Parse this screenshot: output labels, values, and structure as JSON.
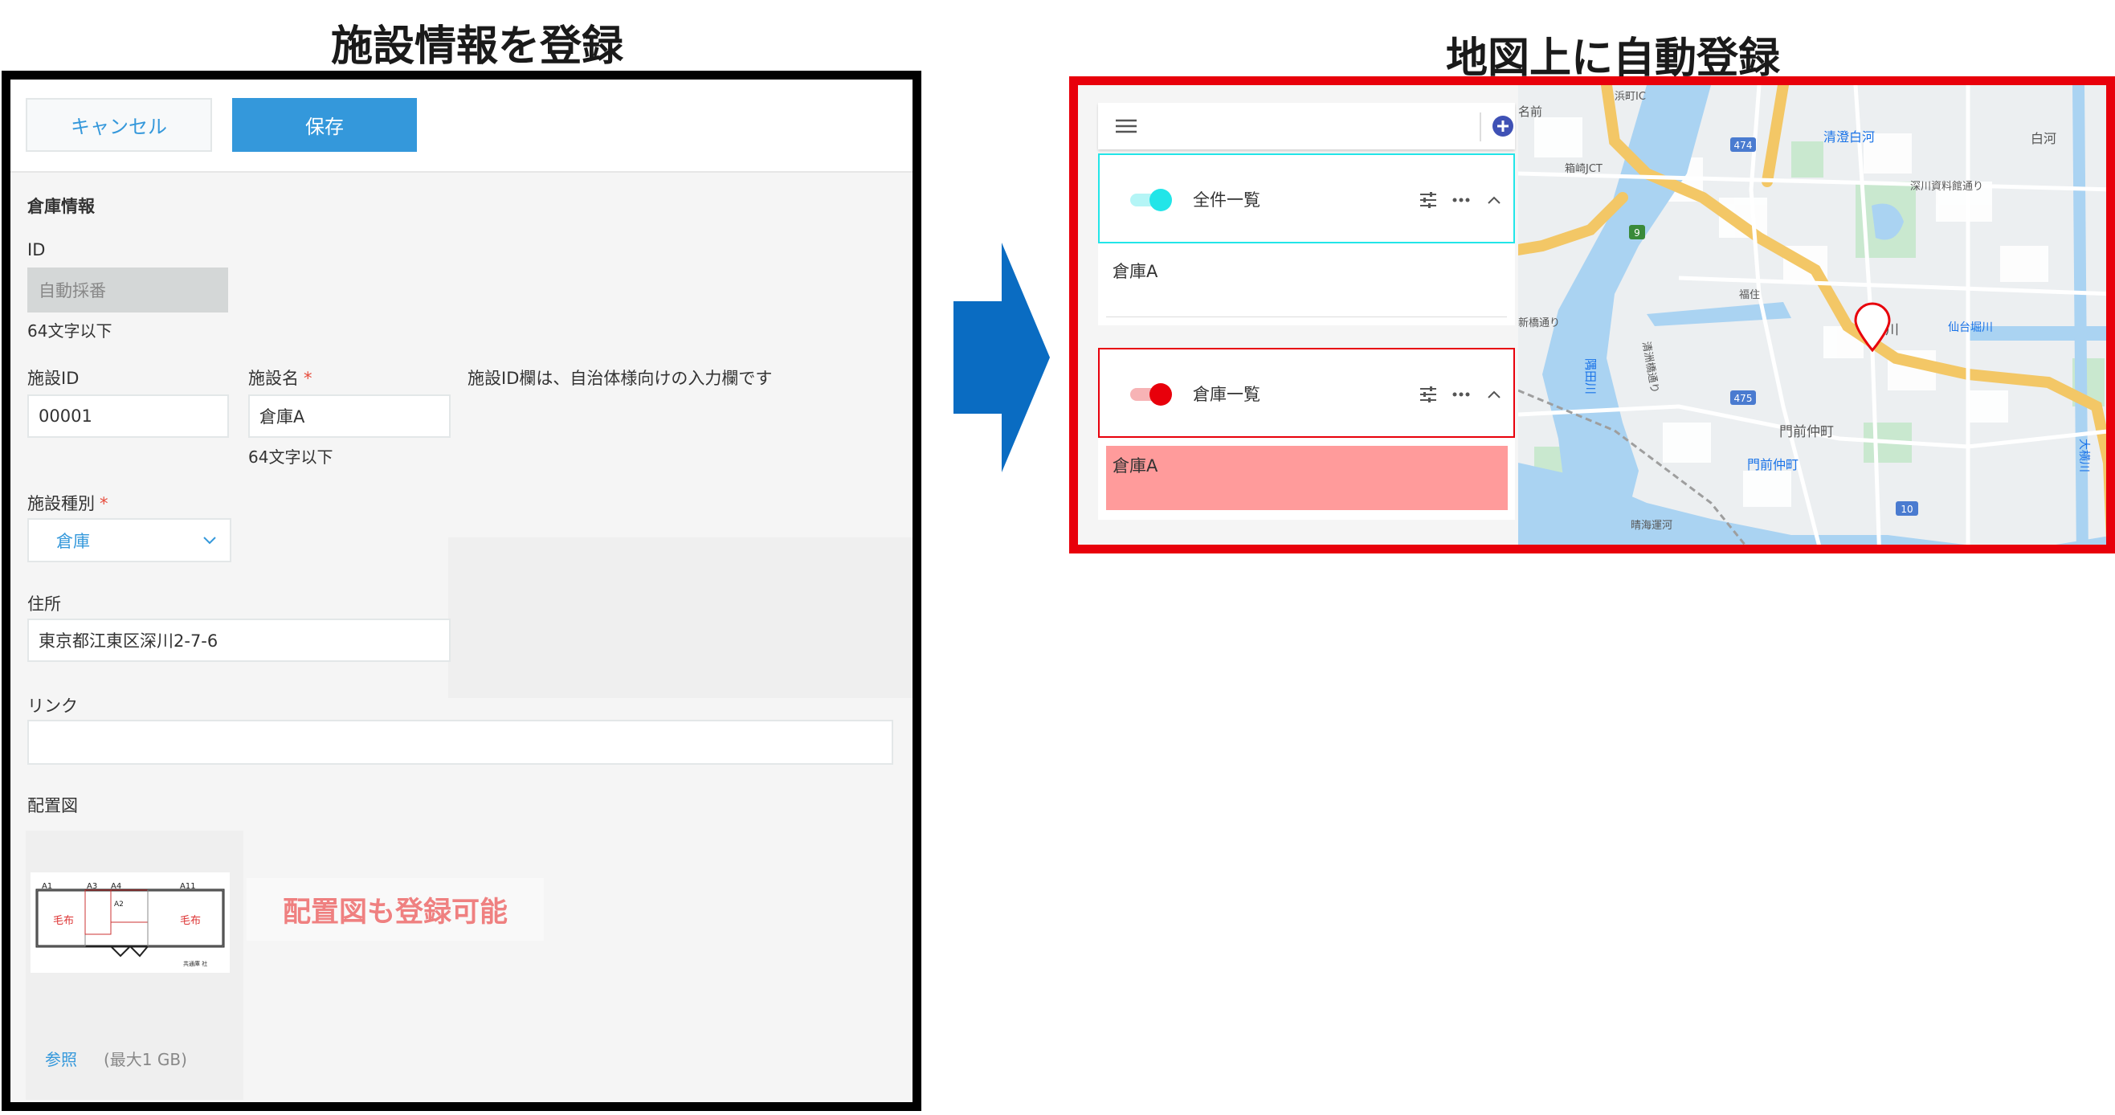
{
  "headings": {
    "left": "施設情報を登録",
    "right": "地図上に自動登録"
  },
  "toolbar": {
    "cancel_label": "キャンセル",
    "save_label": "保存"
  },
  "form": {
    "section_title": "倉庫情報",
    "id_label": "ID",
    "id_value": "自動採番",
    "id_hint": "64文字以下",
    "facility_id_label": "施設ID",
    "facility_id_value": "00001",
    "facility_name_label": "施設名",
    "facility_name_value": "倉庫A",
    "facility_name_hint": "64文字以下",
    "facility_id_note": "施設ID欄は、自治体様向けの入力欄です",
    "type_label": "施設種別",
    "type_value": "倉庫",
    "required_mark": "*",
    "address_label": "住所",
    "address_value": "東京都江東区深川2-7-6",
    "link_label": "リンク",
    "link_value": "",
    "layout_label": "配置図",
    "browse_label": "参照",
    "max_size": "(最大1 GB)",
    "layout_note": "配置図も登録可能",
    "plan": {
      "labels": [
        "A1",
        "A3",
        "A4",
        "A11",
        "A2"
      ],
      "blanket1": "毛布",
      "blanket2": "毛布",
      "caption": "共通庫 社"
    }
  },
  "map_panel": {
    "layers": [
      {
        "title": "全件一覧",
        "color": "#22e5e8",
        "items": [
          "倉庫A"
        ]
      },
      {
        "title": "倉庫一覧",
        "color": "#e8000b",
        "items": [
          "倉庫A"
        ]
      }
    ],
    "map_labels": {
      "l1": "浜町IC",
      "l2": "箱崎JCT",
      "l3": "清澄白河",
      "l4": "白河",
      "l5": "深川資料館通り",
      "l6": "福住",
      "l7": "深川",
      "l8": "仙台堀川",
      "l9": "隅田川",
      "l10": "門前仲町",
      "l11": "晴海運河",
      "l12": "清洲橋通り",
      "l13": "大横川",
      "r474": "474",
      "r475": "475",
      "r9": "9",
      "r10": "10",
      "edge1": "名前",
      "edge2": "新橋通り"
    }
  },
  "colors": {
    "accent_blue": "#3498db",
    "required_red": "#e74c3c",
    "panel_red": "#e8000b",
    "arrow_blue": "#0a6cc2",
    "cyan": "#22e5e8",
    "highlight_pink": "#ff9b9b"
  },
  "icons": [
    "hamburger-icon",
    "add-circle-icon",
    "tune-icon",
    "more-icon",
    "chevron-up-icon",
    "chevron-down-icon",
    "location-pin-icon"
  ]
}
